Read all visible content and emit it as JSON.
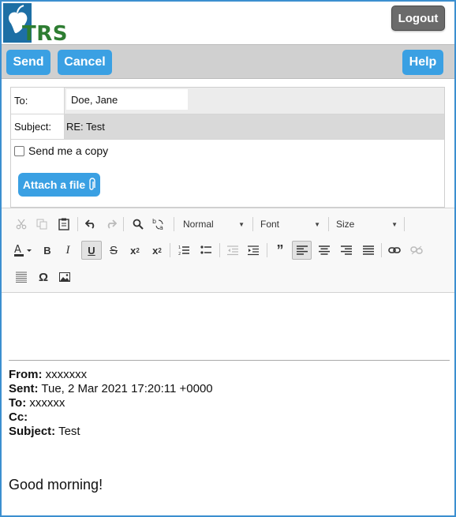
{
  "header": {
    "logo_text": "TRS",
    "logout_label": "Logout"
  },
  "actions": {
    "send_label": "Send",
    "cancel_label": "Cancel",
    "help_label": "Help"
  },
  "form": {
    "to_label": "To:",
    "to_value": "Doe, Jane",
    "subject_label": "Subject:",
    "subject_value": "RE: Test",
    "copy_label": "Send me a copy",
    "copy_checked": false,
    "attach_label": "Attach a file"
  },
  "toolbar": {
    "format_label": "Normal",
    "font_label": "Font",
    "size_label": "Size"
  },
  "message": {
    "from_label": "From:",
    "from_value": " xxxxxxx",
    "sent_label": "Sent:",
    "sent_value": " Tue, 2 Mar 2021 17:20:11 +0000",
    "to_label": "To:",
    "to_value": " xxxxxx",
    "cc_label": "Cc:",
    "subject_label": "Subject:",
    "subject_value": " Test",
    "greeting": "Good morning!"
  },
  "colors": {
    "accent": "#3aa0e3",
    "frame": "#3c8fd0",
    "logo_green": "#2e7d32",
    "logo_blue": "#1d6fa5",
    "logout_gray": "#6b6b6b"
  }
}
